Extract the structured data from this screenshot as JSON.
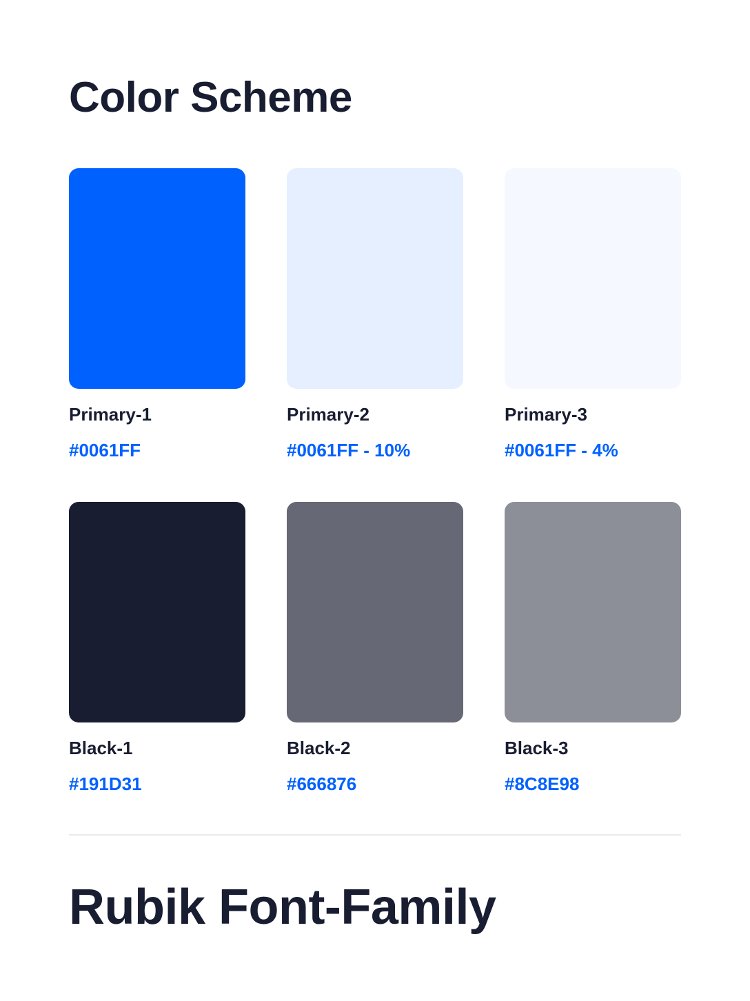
{
  "page_title": "Color Scheme",
  "section_title": "Rubik Font-Family",
  "colors": {
    "text_dark": "#191D31",
    "accent": "#0061FF",
    "divider": "#E8EAEE"
  },
  "swatches": [
    {
      "name": "Primary-1",
      "code": "#0061FF",
      "fill": "#0061FF"
    },
    {
      "name": "Primary-2",
      "code": "#0061FF - 10%",
      "fill": "#E6EFFF"
    },
    {
      "name": "Primary-3",
      "code": "#0061FF - 4%",
      "fill": "#F5F8FF"
    },
    {
      "name": "Black-1",
      "code": "#191D31",
      "fill": "#191D31"
    },
    {
      "name": "Black-2",
      "code": "#666876",
      "fill": "#666876"
    },
    {
      "name": "Black-3",
      "code": "#8C8E98",
      "fill": "#8C8E98"
    }
  ]
}
